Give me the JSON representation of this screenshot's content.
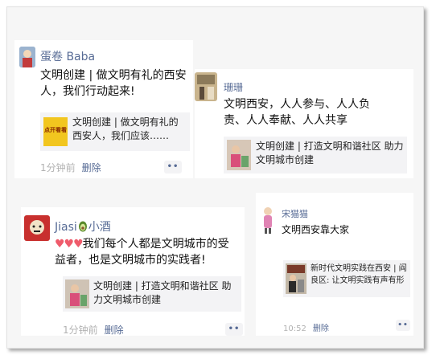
{
  "posts": [
    {
      "name": "蛋卷 Baba",
      "text": "文明创建 | 做文明有礼的西安人，我们行动起来!",
      "link_thumb_text": "点开看看",
      "link_title": "文明创建 | 做文明有礼的西安人，我们应该……",
      "time": "1分钟前",
      "delete_label": "删除"
    },
    {
      "name": "珊珊",
      "text": "文明西安，人人参与、人人负责、人人奉献、人人共享",
      "link_title": "文明创建 | 打造文明和谐社区 助力文明城市创建"
    },
    {
      "name": "Jiasi",
      "name_suffix": "小酒",
      "hearts": "♥♥♥",
      "text": "我们每个人都是文明城市的受益者，也是文明城市的实践者!",
      "link_title": "文明创建 | 打造文明和谐社区 助力文明城市创建",
      "time": "1分钟前",
      "delete_label": "删除"
    },
    {
      "name": "宋猫猫",
      "text": "文明西安靠大家",
      "link_title": "新时代文明实践在西安 | 阎良区: 让文明实践有声有形",
      "time": "10:52",
      "delete_label": "删除"
    }
  ],
  "more_glyph": "••",
  "colors": {
    "name": "#576b95",
    "meta": "#b2b2b2",
    "link_bg": "#f3f3f5",
    "heart": "#ef5b6b"
  }
}
